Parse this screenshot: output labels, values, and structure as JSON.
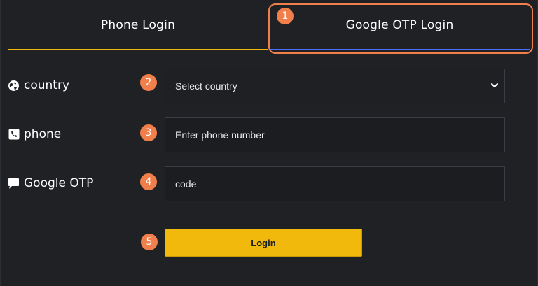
{
  "tabs": {
    "phone_label": "Phone Login",
    "google_label": "Google OTP Login"
  },
  "form": {
    "country": {
      "label": "country",
      "selected": "Select country",
      "icon": "globe-icon"
    },
    "phone": {
      "label": "phone",
      "placeholder": "Enter phone number",
      "icon": "phone-icon"
    },
    "otp": {
      "label": "Google OTP",
      "placeholder": "code",
      "icon": "chat-bubble-icon"
    },
    "login_label": "Login"
  },
  "markers": [
    "1",
    "2",
    "3",
    "4",
    "5"
  ],
  "colors": {
    "background": "#1f2125",
    "accent": "#f0b90b",
    "active_tab_underline": "#4b6ef5",
    "marker": "#f07f4b"
  }
}
